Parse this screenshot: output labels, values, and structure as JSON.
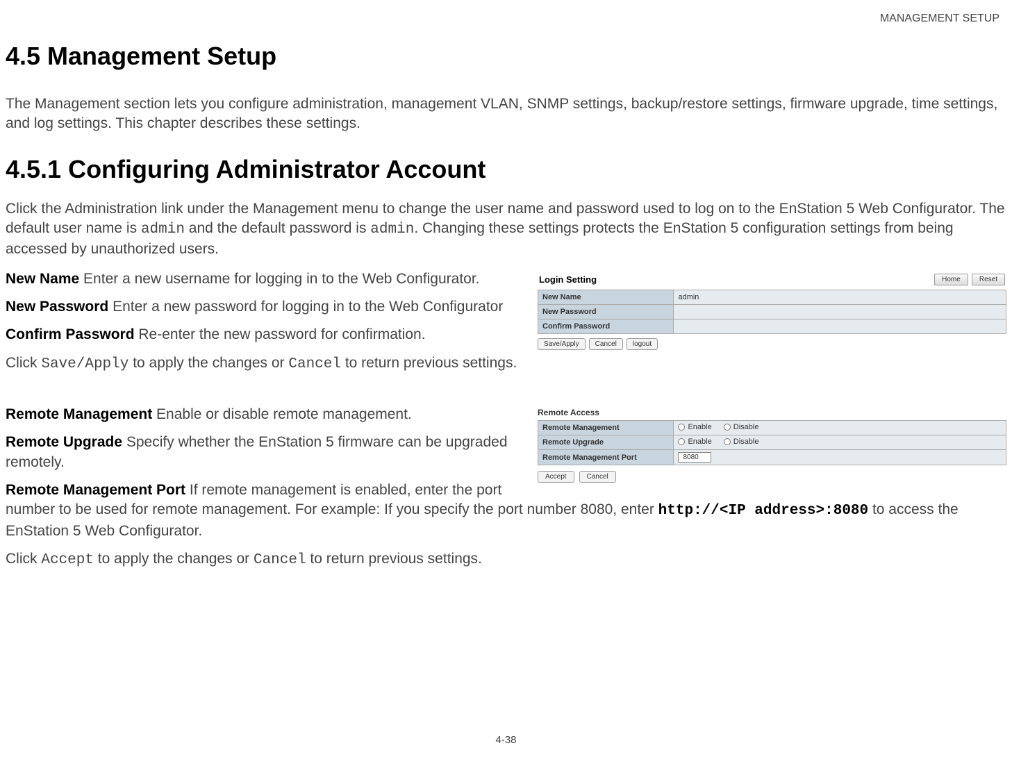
{
  "header": {
    "running_head": "MANAGEMENT SETUP"
  },
  "headings": {
    "main": "4.5 Management Setup",
    "sub1": "4.5.1 Configuring Administrator Account"
  },
  "intro": "The Management section lets you configure administration, management VLAN, SNMP settings, backup/restore settings, firmware upgrade, time settings, and log settings. This chapter describes these settings.",
  "admin_intro": {
    "pre1": "Click the Administration link under the Management menu to change the user name and password used to log on to the EnStation 5 Web Configurator. The default user name is ",
    "code1": "admin",
    "mid1": " and the default password is ",
    "code2": "admin",
    "post1": ". Changing these settings protects the EnStation 5 configuration settings from being accessed by unauthorized users."
  },
  "fields": {
    "new_name_label": "New Name",
    "new_name_desc": "  Enter a new username for logging in to the Web Configurator.",
    "new_password_label": "New Password",
    "new_password_desc": "  Enter a new password for logging in to the Web Configurator",
    "confirm_password_label": "Confirm Password",
    "confirm_password_desc": "  Re-enter the new password for confirmation."
  },
  "save_line": {
    "pre": "Click ",
    "code1": "Save/Apply",
    "mid": " to apply the changes or ",
    "code2": "Cancel",
    "post": " to return previous settings."
  },
  "remote_fields": {
    "rm_label": "Remote Management",
    "rm_desc": "  Enable or disable remote management.",
    "ru_label": "Remote Upgrade",
    "ru_desc": "  Specify whether the EnStation 5 firmware can be upgraded remotely.",
    "rmp_label": "Remote Management Port",
    "rmp_desc_pre": "  If remote management is enabled, enter the port number to be used for remote management. For example: If you specify the port number 8080, enter ",
    "rmp_code": "http://<IP address>:8080",
    "rmp_desc_post": " to access the EnStation 5 Web Configurator."
  },
  "accept_line": {
    "pre": "Click ",
    "code1": "Accept",
    "mid": " to apply the changes or ",
    "code2": "Cancel",
    "post": " to return previous settings."
  },
  "fig1": {
    "title": "Login Setting",
    "buttons_top": {
      "home": "Home",
      "reset": "Reset"
    },
    "rows": {
      "new_name": {
        "k": "New Name",
        "v": "admin"
      },
      "new_password": {
        "k": "New Password",
        "v": ""
      },
      "confirm_password": {
        "k": "Confirm Password",
        "v": ""
      }
    },
    "buttons_bot": {
      "save": "Save/Apply",
      "cancel": "Cancel",
      "logout": "logout"
    }
  },
  "fig2": {
    "title": "Remote Access",
    "rows": {
      "rm": {
        "k": "Remote Management",
        "opt_enable": "Enable",
        "opt_disable": "Disable"
      },
      "ru": {
        "k": "Remote Upgrade",
        "opt_enable": "Enable",
        "opt_disable": "Disable"
      },
      "rmp": {
        "k": "Remote Management Port",
        "v": "8080"
      }
    },
    "buttons_bot": {
      "accept": "Accept",
      "cancel": "Cancel"
    }
  },
  "page_number": "4-38"
}
